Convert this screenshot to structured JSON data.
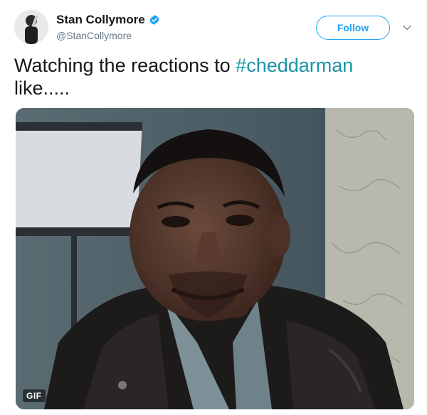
{
  "tweet": {
    "author": {
      "display_name": "Stan Collymore",
      "handle": "@StanCollymore",
      "verified": true
    },
    "follow_label": "Follow",
    "text_prefix": "Watching the reactions to ",
    "hashtag": "#cheddarman",
    "text_suffix": " like.....",
    "media": {
      "type": "animated-gif",
      "badge": "GIF"
    }
  },
  "colors": {
    "accent": "#1da1f2",
    "hashtag": "#1b95a6",
    "text": "#14171a",
    "secondary_text": "#657786"
  },
  "icons": {
    "verified": "verified-badge-icon",
    "caret": "chevron-down-icon"
  }
}
